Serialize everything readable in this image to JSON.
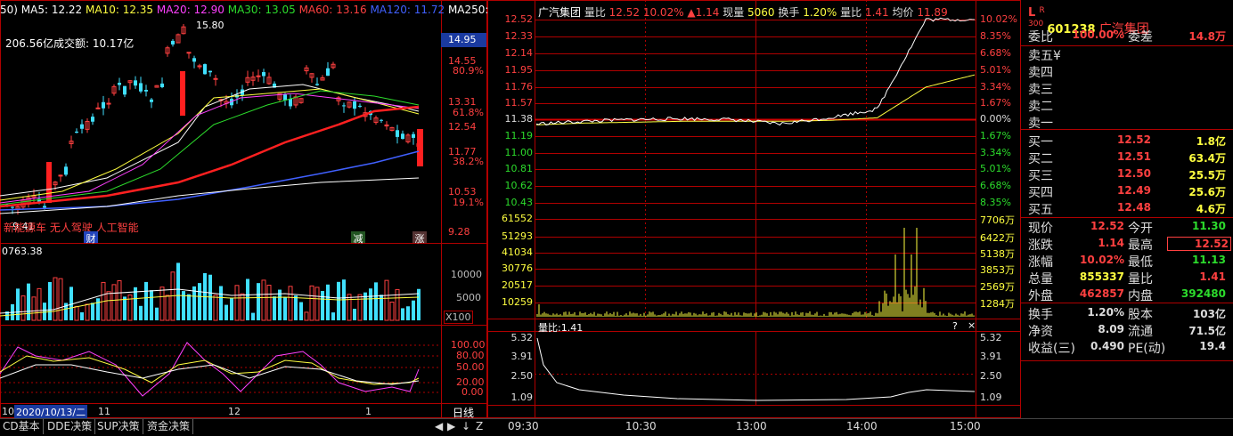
{
  "kline": {
    "ma_legend": [
      {
        "text": "50)",
        "color": "#ffffff"
      },
      {
        "text": "MA5: 12.22",
        "color": "#ffffff"
      },
      {
        "text": "MA10: 12.35",
        "color": "#ffff40"
      },
      {
        "text": "MA20: 12.90",
        "color": "#ff40ff"
      },
      {
        "text": "MA30: 13.05",
        "color": "#2cdc2c"
      },
      {
        "text": "MA60: 13.16",
        "color": "#ff4040"
      },
      {
        "text": "MA120: 11.72",
        "color": "#4060ff"
      },
      {
        "text": "MA250:",
        "color": "#ffffff"
      }
    ],
    "turnover_label": "206.56亿成交额: 10.17亿",
    "high_mark": "15.80",
    "low_mark": "9.41",
    "price_ticks": [
      "14.95",
      "14.55",
      "80.9%",
      "13.31",
      "61.8%",
      "12.54",
      "11.77",
      "38.2%",
      "10.53",
      "19.1%",
      "9.28"
    ],
    "concepts": "新能源车 无人驾驶 人工智能",
    "markers": [
      "财",
      "减",
      "涨"
    ],
    "vol_title": "0763.38",
    "vol_ticks": [
      "10000",
      "5000",
      "X100"
    ],
    "osc_ticks": [
      "100.00",
      "80.00",
      "50.00",
      "20.00",
      "0.00"
    ],
    "date_axis": [
      "10",
      "2020/10/13/二",
      "11",
      "12",
      "1"
    ],
    "period": "日线"
  },
  "intraday": {
    "title_name": "广汽集团",
    "title_items": [
      {
        "text": "量比",
        "color": "#dddddd"
      },
      {
        "text": "12.52",
        "color": "#ff4040"
      },
      {
        "text": "10.02%",
        "color": "#ff4040"
      },
      {
        "text": "▲1.14",
        "color": "#ff4040"
      },
      {
        "text": "现量",
        "color": "#dddddd"
      },
      {
        "text": "5060",
        "color": "#ffff40"
      },
      {
        "text": "换手",
        "color": "#dddddd"
      },
      {
        "text": "1.20%",
        "color": "#ffff40"
      },
      {
        "text": "量比",
        "color": "#dddddd"
      },
      {
        "text": "1.41",
        "color": "#ff4040"
      },
      {
        "text": "均价",
        "color": "#dddddd"
      },
      {
        "text": "11.89",
        "color": "#ff4040"
      }
    ],
    "price_left": [
      "12.52",
      "12.33",
      "12.14",
      "11.95",
      "11.76",
      "11.57",
      "11.38",
      "11.19",
      "11.00",
      "10.81",
      "10.62",
      "10.43"
    ],
    "pct_right": [
      "10.02%",
      "8.35%",
      "6.68%",
      "5.01%",
      "3.34%",
      "1.67%",
      "0.00%",
      "1.67%",
      "3.34%",
      "5.01%",
      "6.68%",
      "8.35%"
    ],
    "vol_left": [
      "61552",
      "51293",
      "41034",
      "30776",
      "20517",
      "10259"
    ],
    "vol_right": [
      "7706万",
      "6422万",
      "5138万",
      "3853万",
      "2569万",
      "1284万"
    ],
    "lb_title": "量比:1.41",
    "lb_ticks": [
      "5.32",
      "3.91",
      "2.50",
      "1.09"
    ],
    "time_axis": [
      "09:30",
      "10:30",
      "13:00",
      "14:00",
      "15:00"
    ],
    "chart_data": {
      "type": "line",
      "x": [
        "09:30",
        "10:00",
        "10:30",
        "11:00",
        "11:30",
        "13:00",
        "13:30",
        "14:00",
        "14:30",
        "15:00"
      ],
      "series": [
        {
          "name": "price",
          "values": [
            11.33,
            11.36,
            11.38,
            11.39,
            11.38,
            11.33,
            11.4,
            11.5,
            12.52,
            12.52
          ]
        },
        {
          "name": "avg",
          "values": [
            11.32,
            11.34,
            11.35,
            11.36,
            11.36,
            11.36,
            11.37,
            11.4,
            11.75,
            11.89
          ]
        }
      ],
      "ylim": [
        10.43,
        12.52
      ]
    }
  },
  "quote": {
    "code": "601238",
    "name": "广汽集团",
    "wb_label": "委比",
    "wb_value": "100.00%",
    "wc_label": "委差",
    "wc_value": "14.8万",
    "sells": [
      "卖五¥",
      "卖四",
      "卖三",
      "卖二",
      "卖一"
    ],
    "buys": [
      {
        "label": "买一",
        "price": "12.52",
        "vol": "1.8亿"
      },
      {
        "label": "买二",
        "price": "12.51",
        "vol": "63.4万"
      },
      {
        "label": "买三",
        "price": "12.50",
        "vol": "25.5万"
      },
      {
        "label": "买四",
        "price": "12.49",
        "vol": "25.6万"
      },
      {
        "label": "买五",
        "price": "12.48",
        "vol": "4.6万"
      }
    ],
    "stats": [
      {
        "l1": "现价",
        "v1": "12.52",
        "c1": "#ff4040",
        "l2": "今开",
        "v2": "11.30",
        "c2": "#2cdc2c"
      },
      {
        "l1": "涨跌",
        "v1": "1.14",
        "c1": "#ff4040",
        "l2": "最高",
        "v2": "12.52",
        "c2": "#ff4040"
      },
      {
        "l1": "涨幅",
        "v1": "10.02%",
        "c1": "#ff4040",
        "l2": "最低",
        "v2": "11.13",
        "c2": "#2cdc2c"
      },
      {
        "l1": "总量",
        "v1": "855337",
        "c1": "#ffff40",
        "l2": "量比",
        "v2": "1.41",
        "c2": "#ff4040"
      },
      {
        "l1": "外盘",
        "v1": "462857",
        "c1": "#ff4040",
        "l2": "内盘",
        "v2": "392480",
        "c2": "#2cdc2c"
      }
    ],
    "stats2": [
      {
        "l1": "换手",
        "v1": "1.20%",
        "l2": "股本",
        "v2": "103亿"
      },
      {
        "l1": "净资",
        "v1": "8.09",
        "l2": "流通",
        "v2": "71.5亿"
      },
      {
        "l1": "收益(三)",
        "v1": "0.490",
        "l2": "PE(动)",
        "v2": "19.4"
      }
    ]
  },
  "bottom_tabs": [
    "CD基本",
    "DDE决策",
    "SUP决策",
    "资金决策"
  ]
}
